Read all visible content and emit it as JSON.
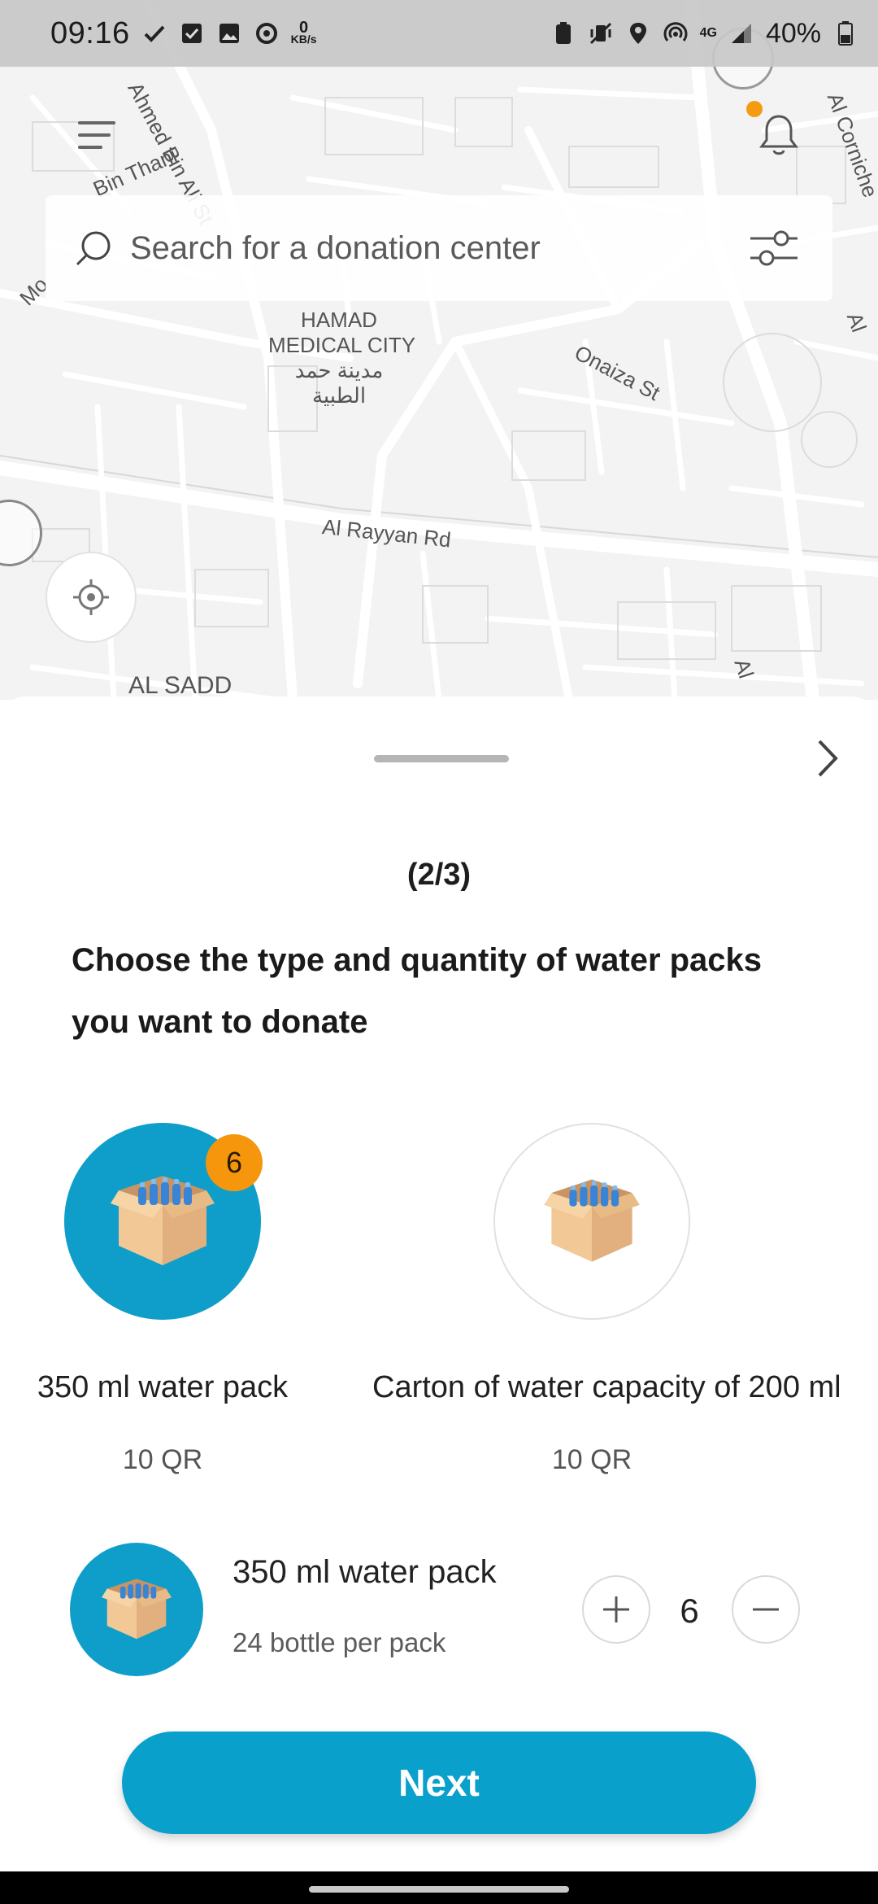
{
  "status_bar": {
    "time": "09:16",
    "net_speed_value": "0",
    "net_speed_unit": "KB/s",
    "battery": "40%",
    "network_type": "4G",
    "left_icons": [
      "check-icon",
      "checkbox-icon",
      "image-icon",
      "sync-icon"
    ],
    "right_icons": [
      "battery-saver-icon",
      "vibrate-icon",
      "location-icon",
      "hotspot-icon",
      "signal-icon"
    ]
  },
  "map": {
    "labels": {
      "street_ahmed": "Ahmed Bin Ali St",
      "street_thani": "Bin Thani",
      "district": "HAMAD",
      "district_line2": "MEDICAL CITY",
      "district_arabic_1": "مدينة حمد",
      "district_arabic_2": "الطبية",
      "onaiza": "Onaiza St",
      "rayyan": "Al Rayyan Rd",
      "sadd": "AL SADD",
      "corniche": "Al Corniche",
      "mo": "Mo",
      "al_right": "Al",
      "al_bottom": "Al"
    }
  },
  "search": {
    "placeholder": "Search for a donation center"
  },
  "sheet": {
    "step": "(2/3)",
    "question": "Choose the type and quantity of water packs you want to donate"
  },
  "packs": [
    {
      "name": "350 ml water pack",
      "price": "10 QR",
      "selected": true,
      "badge": "6"
    },
    {
      "name": "Carton of water capacity of 200 ml",
      "price": "10 QR",
      "selected": false
    }
  ],
  "summary": {
    "name": "350 ml water pack",
    "subtitle": "24 bottle per pack",
    "quantity": "6"
  },
  "next_button": {
    "label": "Next"
  },
  "colors": {
    "accent": "#0aa0cc",
    "badge": "#f5960c",
    "notification_dot": "#f39c12"
  }
}
